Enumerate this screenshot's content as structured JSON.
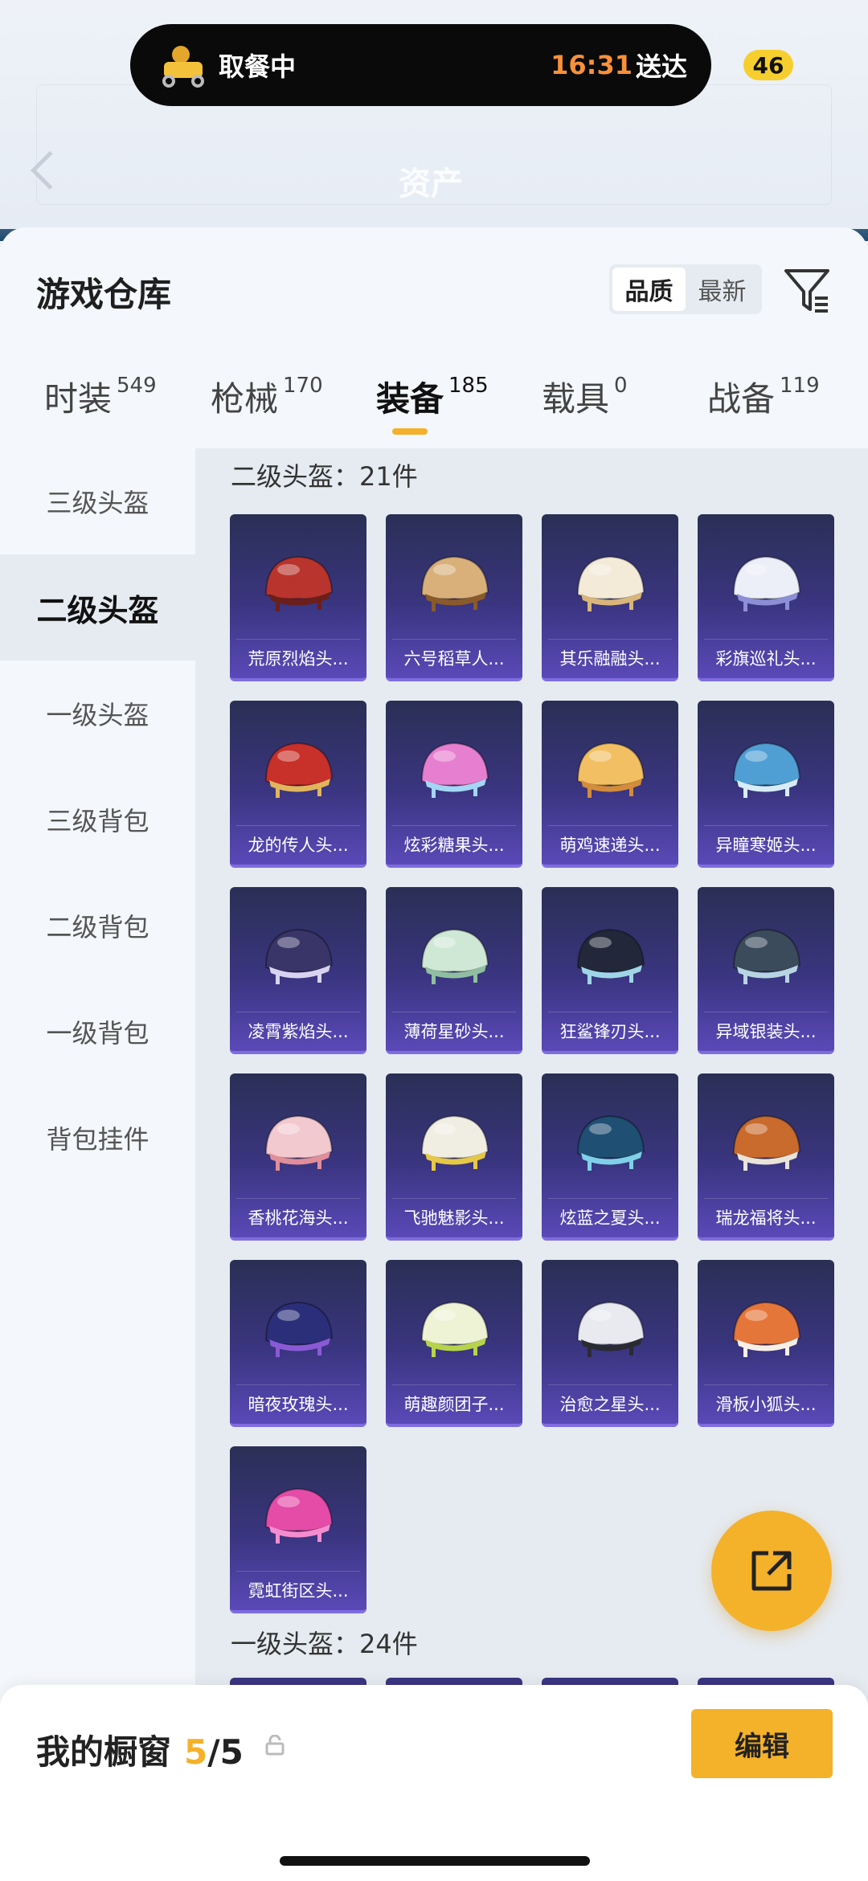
{
  "delivery_pill": {
    "status": "取餐中",
    "time": "16:31",
    "deliver_label": "送达",
    "badge": "46"
  },
  "header_behind": {
    "title": "资产"
  },
  "warehouse": {
    "title": "游戏仓库",
    "sort_options": [
      "品质",
      "最新"
    ],
    "active_sort": "品质"
  },
  "tabs": [
    {
      "label": "时装",
      "count": "549"
    },
    {
      "label": "枪械",
      "count": "170"
    },
    {
      "label": "装备",
      "count": "185"
    },
    {
      "label": "载具",
      "count": "0"
    },
    {
      "label": "战备",
      "count": "119"
    }
  ],
  "active_tab": "装备",
  "side_nav": [
    {
      "label": "三级头盔"
    },
    {
      "label": "二级头盔"
    },
    {
      "label": "一级头盔"
    },
    {
      "label": "三级背包"
    },
    {
      "label": "二级背包"
    },
    {
      "label": "一级背包"
    },
    {
      "label": "背包挂件"
    }
  ],
  "active_side": "二级头盔",
  "sections": [
    {
      "heading": "二级头盔：21件",
      "items": [
        {
          "name": "荒原烈焰头...",
          "color": "#b8342c",
          "accent": "#6a1f1a"
        },
        {
          "name": "六号稻草人...",
          "color": "#d9b07a",
          "accent": "#8a5a2b"
        },
        {
          "name": "其乐融融头...",
          "color": "#f3ead8",
          "accent": "#d8b67a"
        },
        {
          "name": "彩旗巡礼头...",
          "color": "#eceef8",
          "accent": "#8c8fd6"
        },
        {
          "name": "龙的传人头...",
          "color": "#c8302a",
          "accent": "#e2b55c"
        },
        {
          "name": "炫彩糖果头...",
          "color": "#e77fd0",
          "accent": "#a4d6f5"
        },
        {
          "name": "萌鸡速递头...",
          "color": "#f2c062",
          "accent": "#d28c3a"
        },
        {
          "name": "异瞳寒姬头...",
          "color": "#4f9fd4",
          "accent": "#d6ecf7"
        },
        {
          "name": "凌霄紫焰头...",
          "color": "#3a3568",
          "accent": "#d7d3f0"
        },
        {
          "name": "薄荷星砂头...",
          "color": "#cfe8d6",
          "accent": "#8fbfa0"
        },
        {
          "name": "狂鲨锋刃头...",
          "color": "#22283a",
          "accent": "#9fd6e6"
        },
        {
          "name": "异域银装头...",
          "color": "#3b4b5c",
          "accent": "#b7d4e2"
        },
        {
          "name": "香桃花海头...",
          "color": "#f2c9cf",
          "accent": "#e08e9a"
        },
        {
          "name": "飞驰魅影头...",
          "color": "#f0ede2",
          "accent": "#e6c845"
        },
        {
          "name": "炫蓝之夏头...",
          "color": "#1f4f73",
          "accent": "#7fd0e8"
        },
        {
          "name": "瑞龙福将头...",
          "color": "#c96b2c",
          "accent": "#e9e3d8"
        },
        {
          "name": "暗夜玫瑰头...",
          "color": "#2b2f7a",
          "accent": "#8a5ad6"
        },
        {
          "name": "萌趣颜团子...",
          "color": "#eef3d6",
          "accent": "#b6d44a"
        },
        {
          "name": "治愈之星头...",
          "color": "#e9eaf0",
          "accent": "#2a2a33"
        },
        {
          "name": "滑板小狐头...",
          "color": "#e5763a",
          "accent": "#f7efe6"
        },
        {
          "name": "霓虹街区头...",
          "color": "#e44ca8",
          "accent": "#f58cd0"
        }
      ]
    },
    {
      "heading": "一级头盔：24件"
    }
  ],
  "bottom": {
    "window_title": "我的橱窗",
    "window_count": "5",
    "window_total": "/5",
    "edit_label": "编辑"
  }
}
